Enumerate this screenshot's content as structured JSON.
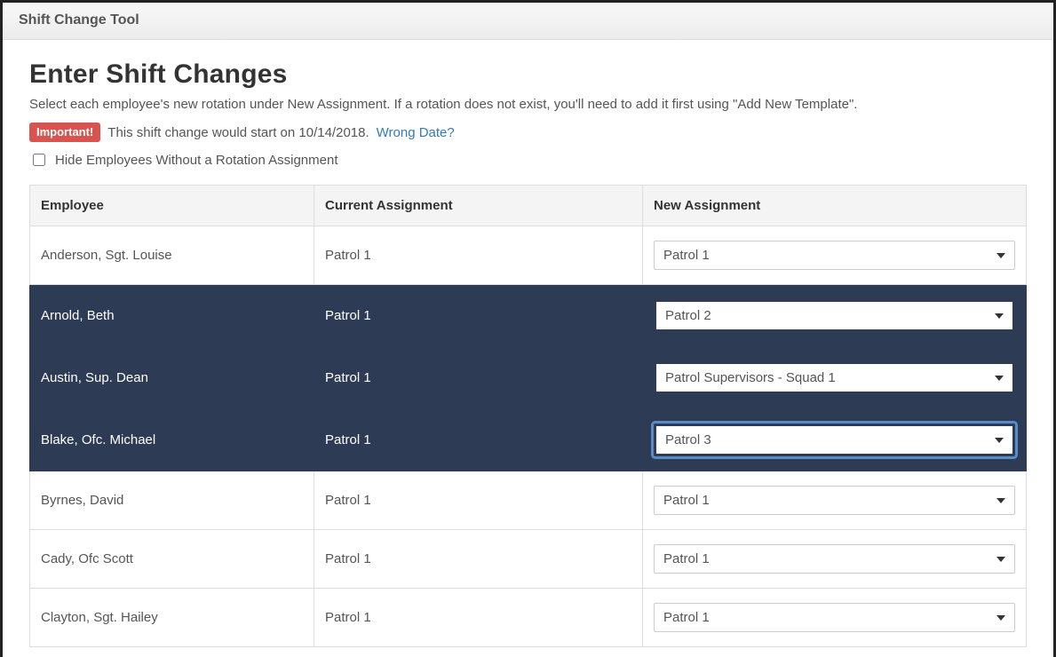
{
  "header": {
    "tool_title": "Shift Change Tool"
  },
  "page": {
    "title": "Enter Shift Changes",
    "instructions": "Select each employee's new rotation under New Assignment. If a rotation does not exist, you'll need to add it first using \"Add New Template\".",
    "important_badge": "Important!",
    "important_text": "This shift change would start on 10/14/2018.",
    "wrong_date_link": "Wrong Date?",
    "hide_checkbox_label": "Hide Employees Without a Rotation Assignment"
  },
  "table": {
    "columns": {
      "employee": "Employee",
      "current": "Current Assignment",
      "newcol": "New Assignment"
    },
    "rows": [
      {
        "employee": "Anderson, Sgt. Louise",
        "current": "Patrol 1",
        "new": "Patrol 1",
        "changed": false,
        "focused": false
      },
      {
        "employee": "Arnold, Beth",
        "current": "Patrol 1",
        "new": "Patrol 2",
        "changed": true,
        "focused": false
      },
      {
        "employee": "Austin, Sup. Dean",
        "current": "Patrol 1",
        "new": "Patrol Supervisors - Squad 1",
        "changed": true,
        "focused": false
      },
      {
        "employee": "Blake, Ofc. Michael",
        "current": "Patrol 1",
        "new": "Patrol 3",
        "changed": true,
        "focused": true
      },
      {
        "employee": "Byrnes, David",
        "current": "Patrol 1",
        "new": "Patrol 1",
        "changed": false,
        "focused": false
      },
      {
        "employee": "Cady, Ofc Scott",
        "current": "Patrol 1",
        "new": "Patrol 1",
        "changed": false,
        "focused": false
      },
      {
        "employee": "Clayton, Sgt. Hailey",
        "current": "Patrol 1",
        "new": "Patrol 1",
        "changed": false,
        "focused": false
      }
    ],
    "options": [
      "Patrol 1",
      "Patrol 2",
      "Patrol 3",
      "Patrol Supervisors - Squad 1"
    ]
  }
}
